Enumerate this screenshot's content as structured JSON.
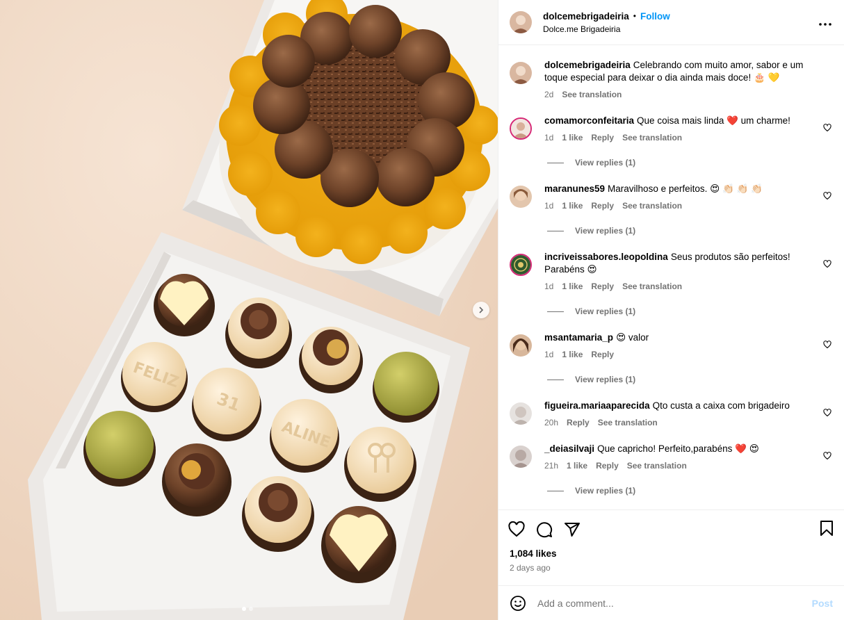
{
  "post": {
    "author": "dolcemebrigadeiria",
    "follow_label": "Follow",
    "subtitle": "Dolce.me Brigadeiria",
    "caption": "Celebrando com muito amor, sabor e um toque especial para deixar o dia ainda mais doce! 🎂 💛",
    "caption_time": "2d",
    "see_translation": "See translation",
    "photo_text": [
      "FELIZ",
      "31",
      "ALINE"
    ]
  },
  "comments": [
    {
      "user": "comamorconfeitaria",
      "text": "Que coisa mais linda ❤️ um charme!",
      "time": "1d",
      "likes": "1 like",
      "reply": "Reply",
      "translate": "See translation",
      "view_replies": "View replies (1)",
      "avatar_color": "#e8d2c7"
    },
    {
      "user": "maranunes59",
      "text": "Maravilhoso e perfeitos. 😍 👏🏻 👏🏻 👏🏻",
      "time": "1d",
      "likes": "1 like",
      "reply": "Reply",
      "translate": "See translation",
      "view_replies": "View replies (1)",
      "avatar_color": "#8a5a3b"
    },
    {
      "user": "incriveissabores.leopoldina",
      "text": "Seus produtos são perfeitos! Parabéns 😍",
      "time": "1d",
      "likes": "1 like",
      "reply": "Reply",
      "translate": "See translation",
      "view_replies": "View replies (1)",
      "avatar_color": "#2f5a2e"
    },
    {
      "user": "msantamaria_p",
      "text": "😍 valor",
      "time": "1d",
      "likes": "1 like",
      "reply": "Reply",
      "translate": "",
      "view_replies": "View replies (1)",
      "avatar_color": "#6b4430"
    },
    {
      "user": "figueira.mariaaparecida",
      "text": "Qto custa a caixa com brigadeiro",
      "time": "20h",
      "likes": "",
      "reply": "Reply",
      "translate": "See translation",
      "view_replies": "",
      "avatar_color": "#c9c2bd"
    },
    {
      "user": "_deiasilvaji",
      "text": "Que capricho! Perfeito,parabéns ❤️ 😍",
      "time": "21h",
      "likes": "1 like",
      "reply": "Reply",
      "translate": "See translation",
      "view_replies": "View replies (1)",
      "avatar_color": "#b9aaa6"
    }
  ],
  "footer": {
    "likes": "1,084 likes",
    "time": "2 days ago",
    "comment_placeholder": "Add a comment...",
    "post_label": "Post"
  },
  "colors": {
    "link": "#0095f6",
    "muted": "#737373",
    "post_disabled": "#b3dbff"
  },
  "icons": [
    "more-options-icon",
    "like-icon",
    "comment-icon",
    "share-icon",
    "save-icon",
    "emoji-icon",
    "next-arrow-icon"
  ]
}
